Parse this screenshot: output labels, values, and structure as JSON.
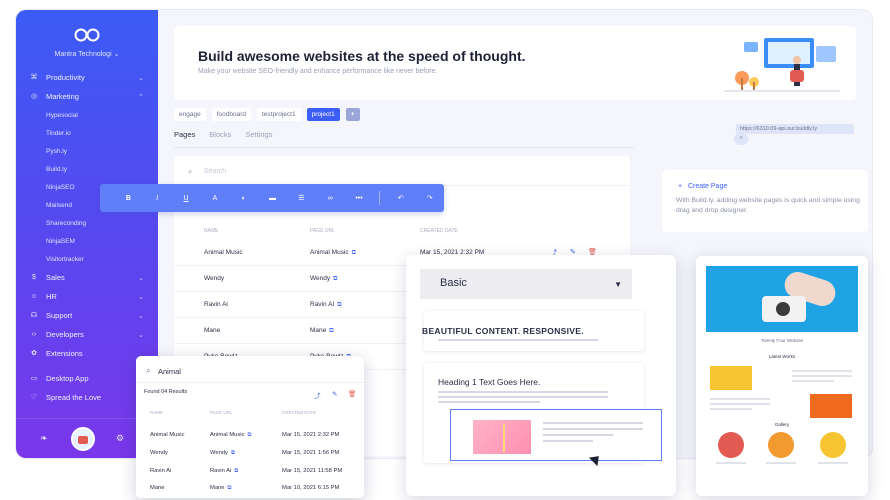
{
  "sidebar": {
    "org_name": "Mantra Technologi",
    "items": [
      {
        "label": "Productivity",
        "icon": "grid-icon"
      },
      {
        "label": "Marketing",
        "icon": "megaphone-icon"
      }
    ],
    "marketing_sub": [
      "Hypesocial",
      "Tinder.io",
      "Pysh.ly",
      "Build.ly",
      "NinjaSEO",
      "Mailsend",
      "Shareconding",
      "NinjaSEM",
      "Visitortracker"
    ],
    "items2": [
      {
        "label": "Sales",
        "icon": "dollar-icon"
      },
      {
        "label": "HR",
        "icon": "people-icon"
      },
      {
        "label": "Support",
        "icon": "headset-icon"
      },
      {
        "label": "Developers",
        "icon": "code-icon"
      },
      {
        "label": "Extensions",
        "icon": "puzzle-icon"
      }
    ],
    "footer_links": [
      {
        "label": "Desktop App",
        "icon": "desktop-icon"
      },
      {
        "label": "Spread the Love",
        "icon": "heart-icon"
      }
    ]
  },
  "banner": {
    "title": "Build awesome websites at the speed of thought.",
    "subtitle": "Make your website SEO-friendly and enhance performance like never before."
  },
  "breadcrumbs": [
    "engage",
    "foodboard",
    "testproject1",
    "project1"
  ],
  "breadcrumb_add": "+",
  "tabs": [
    "Pages",
    "Blocks",
    "Settings"
  ],
  "url_pill": "https://6310.09-api.our.buildly.ly",
  "search": {
    "placeholder": "Search"
  },
  "table": {
    "headers": [
      "NAME",
      "PAGE URL",
      "CREATED DATE"
    ],
    "rows": [
      {
        "name": "Animal Music",
        "url": "Animal Music",
        "date": "Mar 15, 2021 2:32 PM"
      },
      {
        "name": "Wendy",
        "url": "Wendy",
        "date": ""
      },
      {
        "name": "Ravin Ai",
        "url": "Ravin AI",
        "date": ""
      },
      {
        "name": "Mane",
        "url": "Mane",
        "date": ""
      },
      {
        "name": "Pyke Bowlz",
        "url": "Pyke Bowlz",
        "date": ""
      }
    ]
  },
  "toolbar": [
    "B",
    "I",
    "U",
    "A",
    "◐",
    "▬",
    "☰",
    "∞",
    "•••",
    "↶",
    "↷"
  ],
  "create_card": {
    "link": "Create Page",
    "text": "With Build.ly, adding website pages is quick and simple using drag and drop designer."
  },
  "popup": {
    "query": "Animal",
    "results": "Found 04 Results",
    "headers": [
      "NAME",
      "PAGE URL",
      "CREATED DATE"
    ],
    "rows": [
      {
        "name": "Animal Music",
        "url": "Animal Music",
        "date": "Mar 15, 2021 2:32 PM"
      },
      {
        "name": "Wendy",
        "url": "Wendy",
        "date": "Mar 15, 2021 1:56 PM"
      },
      {
        "name": "Ravin Ai",
        "url": "Ravin Ai",
        "date": "Mar 15, 2021 11:58 PM"
      },
      {
        "name": "Mane",
        "url": "Mane",
        "date": "Mar 10, 2021 6:15 PM"
      }
    ]
  },
  "builder": {
    "select_value": "Basic",
    "heading1": "BEAUTIFUL CONTENT. RESPONSIVE.",
    "heading2": "Heading 1 Text Goes Here."
  },
  "preview": {
    "site_title": "Twenty Four Website",
    "latest": "Latest Works",
    "gallery": "Gallery"
  },
  "colors": {
    "accent": "#3c5ef7",
    "sidebar_top": "#3b5bf5",
    "sidebar_bottom": "#7a37ea",
    "toolbar": "#5f7ff8"
  }
}
